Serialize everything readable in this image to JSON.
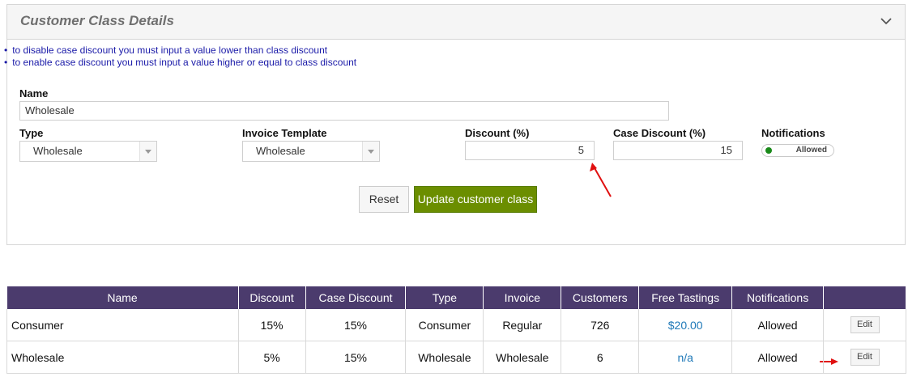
{
  "panel": {
    "title": "Customer Class Details",
    "notes": [
      "to disable case discount you must input a value lower than class discount",
      "to enable case discount you must input a value higher or equal to class discount"
    ],
    "form": {
      "name_label": "Name",
      "name_value": "Wholesale",
      "type_label": "Type",
      "type_value": "Wholesale",
      "invoice_template_label": "Invoice Template",
      "invoice_template_value": "Wholesale",
      "discount_label": "Discount (%)",
      "discount_value": "5",
      "case_discount_label": "Case Discount (%)",
      "case_discount_value": "15",
      "notifications_label": "Notifications",
      "notifications_value": "Allowed"
    },
    "buttons": {
      "reset": "Reset",
      "update": "Update customer class"
    }
  },
  "table": {
    "headers": [
      "Name",
      "Discount",
      "Case Discount",
      "Type",
      "Invoice",
      "Customers",
      "Free Tastings",
      "Notifications",
      ""
    ],
    "rows": [
      {
        "name": "Consumer",
        "discount": "15%",
        "case_discount": "15%",
        "type": "Consumer",
        "invoice": "Regular",
        "customers": "726",
        "free_tastings": "$20.00",
        "notifications": "Allowed",
        "action": "Edit"
      },
      {
        "name": "Wholesale",
        "discount": "5%",
        "case_discount": "15%",
        "type": "Wholesale",
        "invoice": "Wholesale",
        "customers": "6",
        "free_tastings": "n/a",
        "notifications": "Allowed",
        "action": "Edit"
      }
    ]
  },
  "colors": {
    "table_header_bg": "#4b3b6d",
    "update_button_bg": "#6b8e00",
    "note_text": "#1a1aa8",
    "link": "#1f79b8",
    "annotation_arrow": "#e01010",
    "toggle_dot": "#1a8a1a"
  }
}
